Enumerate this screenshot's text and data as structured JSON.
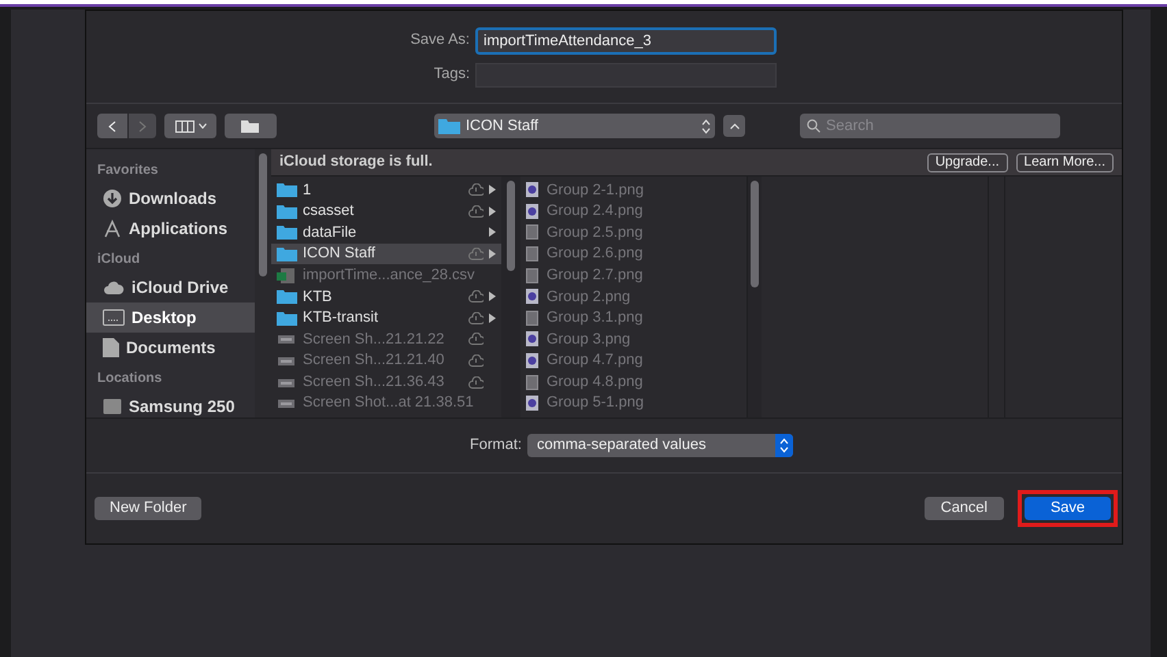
{
  "save_as": {
    "label": "Save As:",
    "value": "importTimeAttendance_3"
  },
  "tags": {
    "label": "Tags:"
  },
  "location": {
    "label": "ICON Staff"
  },
  "search": {
    "placeholder": "Search"
  },
  "sidebar": [
    {
      "heading": "Favorites",
      "items": [
        {
          "label": "Downloads",
          "kind": "download",
          "selected": false
        },
        {
          "label": "Applications",
          "kind": "apps",
          "selected": false
        }
      ]
    },
    {
      "heading": "iCloud",
      "items": [
        {
          "label": "iCloud Drive",
          "kind": "cloud",
          "selected": false
        },
        {
          "label": "Desktop",
          "kind": "desktop",
          "selected": true
        },
        {
          "label": "Documents",
          "kind": "doc",
          "selected": false
        }
      ]
    },
    {
      "heading": "Locations",
      "items": [
        {
          "label": "Samsung 250",
          "kind": "disk",
          "selected": false
        }
      ]
    }
  ],
  "banner": {
    "text": "iCloud storage is full.",
    "buttons": [
      "Upgrade...",
      "Learn More..."
    ]
  },
  "column_1": [
    {
      "label": "1",
      "kind": "folder",
      "cloud": true,
      "arrow": true,
      "selected": false
    },
    {
      "label": "csasset",
      "kind": "folder",
      "cloud": true,
      "arrow": true,
      "selected": false
    },
    {
      "label": "dataFile",
      "kind": "folder",
      "cloud": false,
      "arrow": true,
      "selected": false
    },
    {
      "label": "ICON Staff",
      "kind": "folder",
      "cloud": true,
      "arrow": true,
      "selected": true
    },
    {
      "label": "importTime...ance_28.csv",
      "kind": "csv",
      "cloud": false,
      "arrow": false,
      "selected": false
    },
    {
      "label": "KTB",
      "kind": "folder",
      "cloud": true,
      "arrow": true,
      "selected": false
    },
    {
      "label": "KTB-transit",
      "kind": "folder",
      "cloud": true,
      "arrow": true,
      "selected": false
    },
    {
      "label": "Screen Sh...21.21.22",
      "kind": "screenshot",
      "cloud": true,
      "arrow": false,
      "selected": false
    },
    {
      "label": "Screen Sh...21.21.40",
      "kind": "screenshot",
      "cloud": true,
      "arrow": false,
      "selected": false
    },
    {
      "label": "Screen Sh...21.36.43",
      "kind": "screenshot",
      "cloud": true,
      "arrow": false,
      "selected": false
    },
    {
      "label": "Screen Shot...at 21.38.51",
      "kind": "screenshot",
      "cloud": false,
      "arrow": false,
      "selected": false
    }
  ],
  "column_2": [
    {
      "label": "Group 2-1.png",
      "kind": "image"
    },
    {
      "label": "Group 2.4.png",
      "kind": "image"
    },
    {
      "label": "Group 2.5.png",
      "kind": "blank"
    },
    {
      "label": "Group 2.6.png",
      "kind": "blank"
    },
    {
      "label": "Group 2.7.png",
      "kind": "blank"
    },
    {
      "label": "Group 2.png",
      "kind": "image"
    },
    {
      "label": "Group 3.1.png",
      "kind": "blank"
    },
    {
      "label": "Group 3.png",
      "kind": "image"
    },
    {
      "label": "Group 4.7.png",
      "kind": "image"
    },
    {
      "label": "Group 4.8.png",
      "kind": "blank"
    },
    {
      "label": "Group 5-1.png",
      "kind": "image"
    }
  ],
  "format": {
    "label": "Format:",
    "value": "comma-separated values"
  },
  "buttons": {
    "new_folder": "New Folder",
    "cancel": "Cancel",
    "save": "Save"
  }
}
